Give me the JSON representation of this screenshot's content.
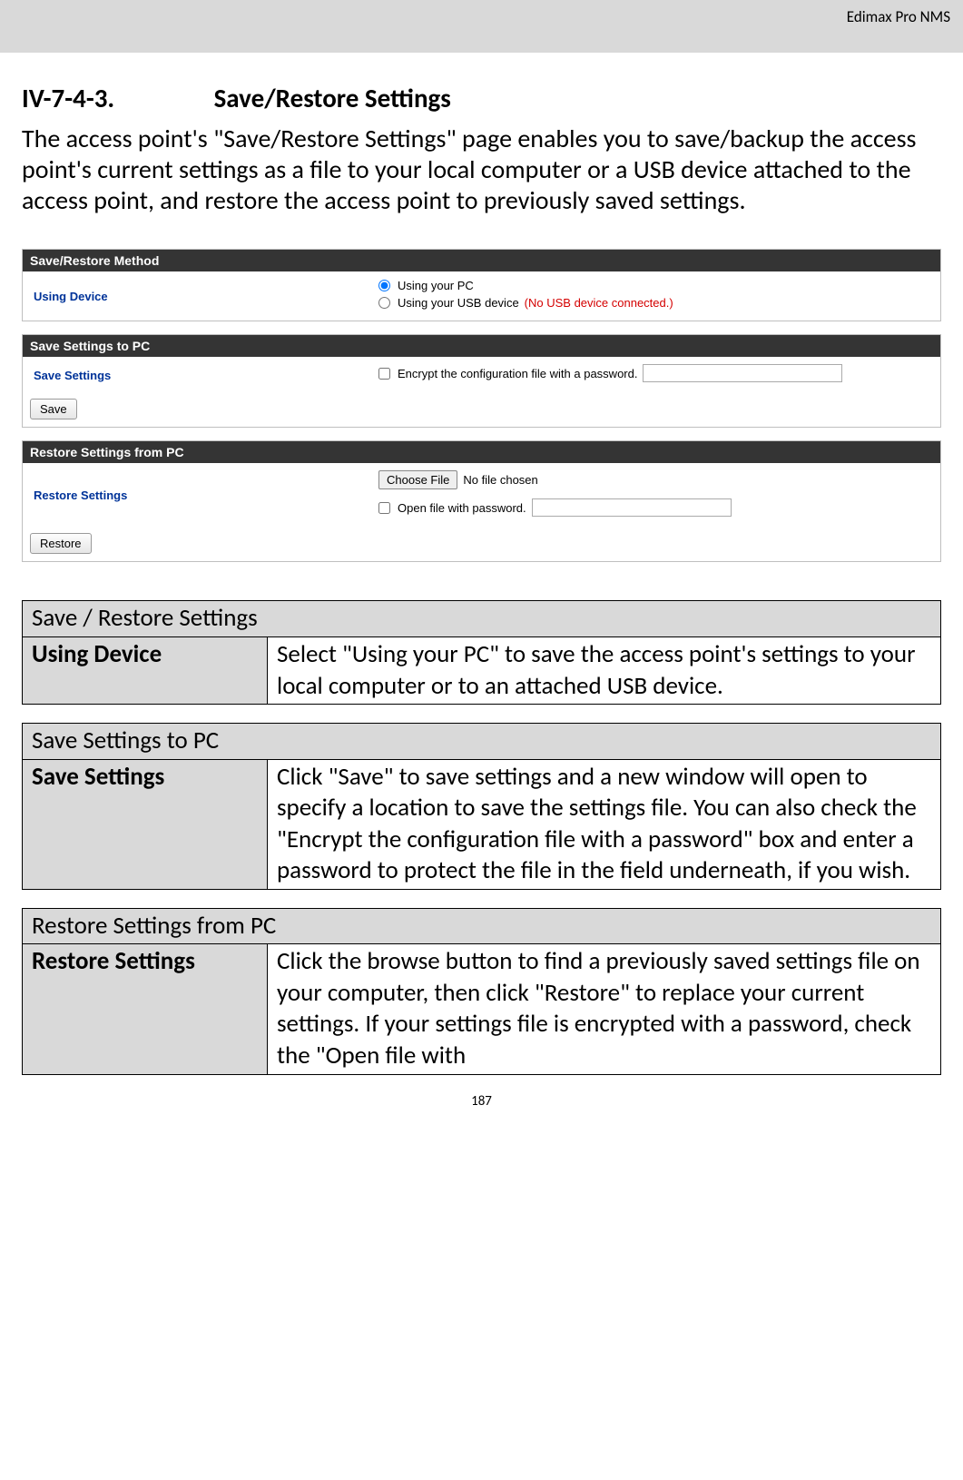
{
  "header": {
    "brand": "Edimax Pro NMS"
  },
  "section": {
    "number": "IV-7-4-3.",
    "title": "Save/Restore Settings"
  },
  "intro": "The access point's \"Save/Restore Settings\" page enables you to save/backup the access point's current settings as a file to your local computer or a USB device attached to the access point, and restore the access point to previously saved settings.",
  "panels": {
    "method": {
      "header": "Save/Restore Method",
      "label": "Using Device",
      "opt_pc": "Using your PC",
      "opt_usb": "Using your USB device",
      "usb_note": "(No USB device connected.)"
    },
    "saveToPC": {
      "header": "Save Settings to PC",
      "label": "Save Settings",
      "encrypt_label": "Encrypt the configuration file with a password.",
      "save_btn": "Save"
    },
    "restoreFromPC": {
      "header": "Restore Settings from PC",
      "label": "Restore Settings",
      "choose_file_btn": "Choose File",
      "no_file": "No file chosen",
      "open_pw_label": "Open file with password.",
      "restore_btn": "Restore"
    }
  },
  "tables": {
    "t1": {
      "caption": "Save / Restore Settings",
      "row_label": "Using Device",
      "row_desc": "Select \"Using your PC\" to save the access point's settings to your local computer or to an attached USB device."
    },
    "t2": {
      "caption": "Save Settings to PC",
      "row_label": "Save Settings",
      "row_desc": "Click \"Save\" to save settings and a new window will open to specify a location to save the settings file. You can also check the \"Encrypt the configuration file with a password\" box and enter a password to protect the file in the field underneath, if you wish."
    },
    "t3": {
      "caption": "Restore Settings from PC",
      "row_label": "Restore Settings",
      "row_desc": "Click the browse button to find a previously saved settings file on your computer, then click \"Restore\" to replace your current settings. If your settings file is encrypted with a password, check the \"Open file with"
    }
  },
  "page_number": "187"
}
